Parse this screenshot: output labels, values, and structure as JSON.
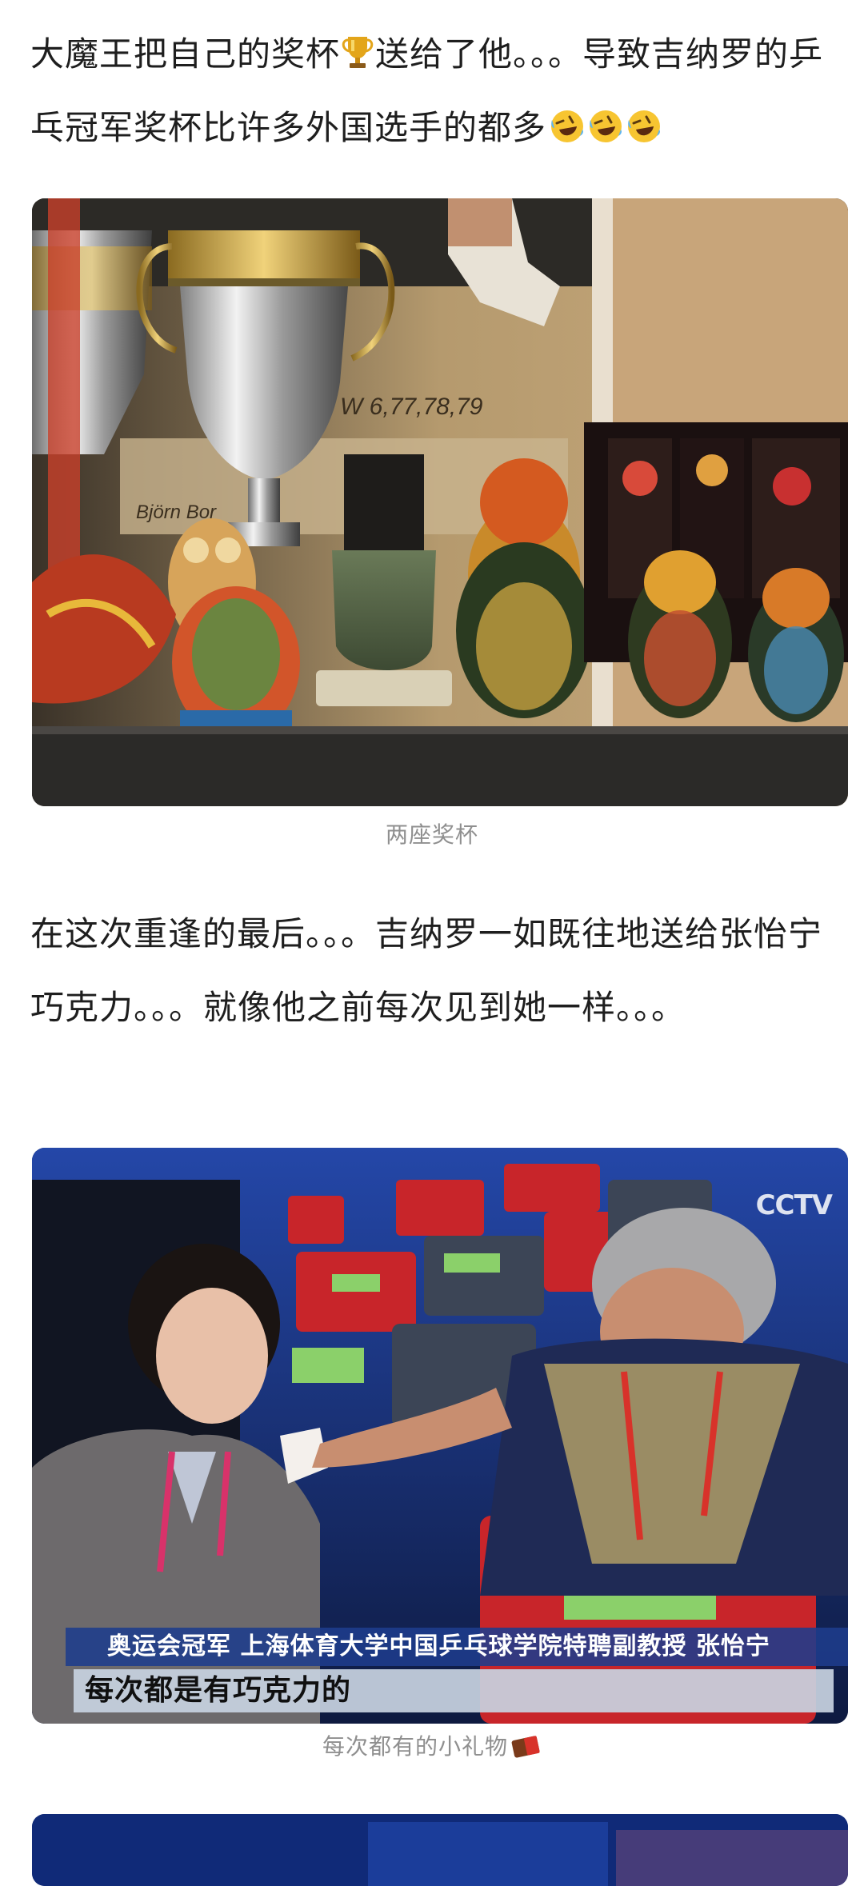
{
  "post": {
    "para1_part1": "大魔王把自己的奖杯",
    "para1_part2": "送给了他。。。导致吉纳罗的乒乓冠军奖杯比许多外国选手的都多",
    "para2": "在这次重逢的最后。。。吉纳罗一如既往地送给张怡宁巧克力。。。就像他之前每次见到她一样。。。"
  },
  "images": {
    "trophy_photo": {
      "nameplate_text": "Björn Bor",
      "years_text": "n W   6,77,78,79",
      "caption": "两座奖杯"
    },
    "tv_photo": {
      "logo_text": "CCTV",
      "banner_title": "奥运会冠军 上海体育大学中国乒乓球学院特聘副教授 张怡宁",
      "subtitle": "每次都是有巧克力的",
      "caption": "每次都有的小礼物"
    }
  },
  "icons": {
    "trophy": "trophy-emoji",
    "laugh": "rolling-on-floor-laughing-emoji",
    "chocolate": "chocolate-bar-emoji"
  },
  "colors": {
    "text": "#1e1e1e",
    "caption": "#8f8f8f",
    "tv_banner": "#1e3c8c"
  }
}
